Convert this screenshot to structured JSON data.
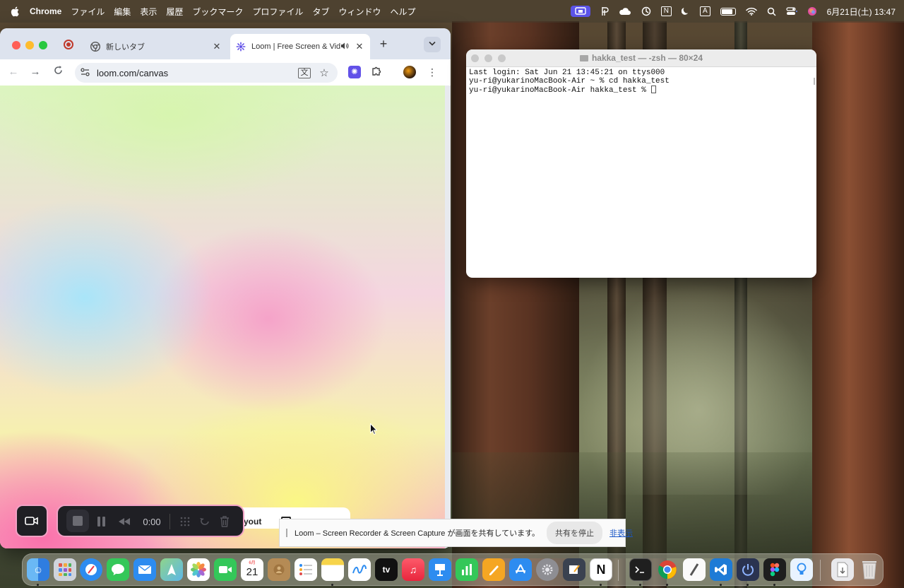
{
  "menubar": {
    "app_name": "Chrome",
    "menus": [
      "ファイル",
      "編集",
      "表示",
      "履歴",
      "ブックマーク",
      "プロファイル",
      "タブ",
      "ウィンドウ",
      "ヘルプ"
    ],
    "input_mode": "A",
    "clock": "6月21日(土) 13:47",
    "notion_letter": "N"
  },
  "chrome": {
    "tabs": [
      {
        "label": "新しいタブ",
        "icon": "chrome-icon"
      },
      {
        "label": "Loom | Free Screen & Vid",
        "icon": "loom-icon",
        "active": true
      }
    ],
    "url": "loom.com/canvas"
  },
  "terminal": {
    "title": "hakka_test — -zsh — 80×24",
    "lines": [
      "Last login: Sat Jun 21 13:45:21 on ttys000",
      "yu-ri@yukarinoMacBook-Air ~ % cd hakka_test",
      "yu-ri@yukarinoMacBook-Air hakka_test % "
    ]
  },
  "loom": {
    "timer": "0:00",
    "peek_label": "yout"
  },
  "sharebar": {
    "message": "Loom – Screen Recorder & Screen Capture が画面を共有しています。",
    "stop_label": "共有を停止",
    "hide_label": "非表示"
  },
  "dock": {
    "calendar_month": "6月",
    "calendar_day": "21",
    "tv_label": "tv"
  },
  "colors": {
    "loom_accent": "#6251e8",
    "loom_border": "#f0a1c4",
    "traffic_red": "#ff5f57",
    "traffic_yellow": "#febc2e",
    "traffic_green": "#28c840"
  }
}
